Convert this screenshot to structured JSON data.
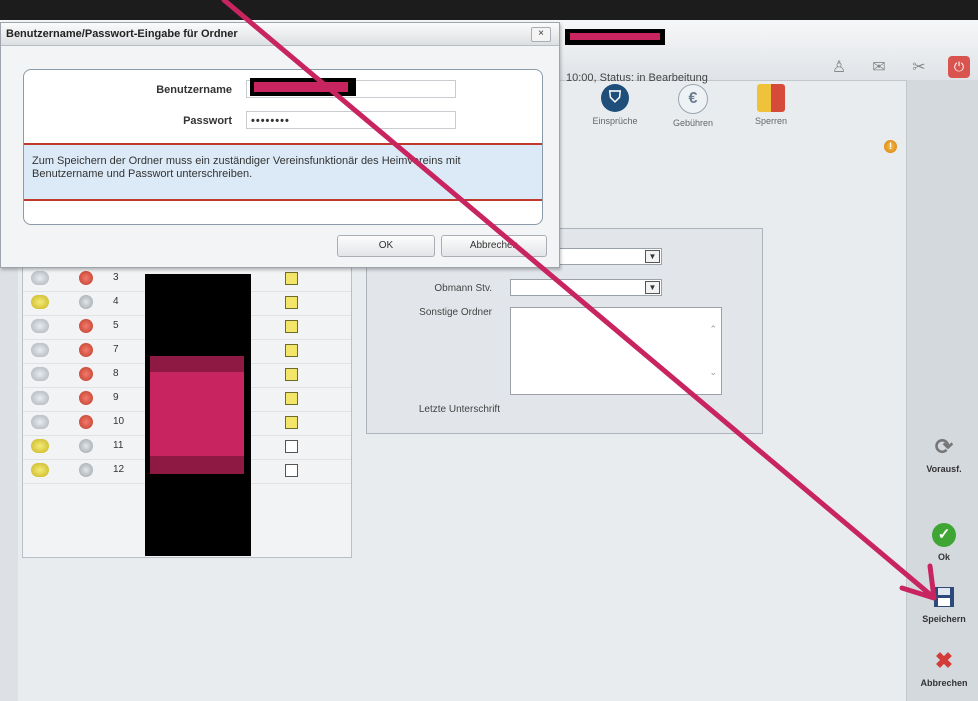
{
  "header": {
    "status_text": "10:00, Status: in Bearbeitung"
  },
  "toolbar": [
    {
      "label": "Einsprüche",
      "icon": "shield-icon",
      "symbol": "⛉",
      "color": "#1e4e79"
    },
    {
      "label": "Gebühren",
      "icon": "euro-icon",
      "symbol": "€",
      "color": "#6a7d90"
    },
    {
      "label": "Sperren",
      "icon": "cards-icon",
      "symbol": "▰",
      "color": "#e2a52b"
    }
  ],
  "sidebar": {
    "vorausfuellen": "Vorausf.",
    "ok": "Ok",
    "speichern": "Speichern",
    "abbrechen": "Abbrechen"
  },
  "table": {
    "rows": [
      {
        "num": "3",
        "ic1": "grey",
        "ic2": "red",
        "chk": "yellow"
      },
      {
        "num": "4",
        "ic1": "yellow",
        "ic2": "grey",
        "chk": "yellow"
      },
      {
        "num": "5",
        "ic1": "grey",
        "ic2": "red",
        "chk": "yellow"
      },
      {
        "num": "7",
        "ic1": "grey",
        "ic2": "red",
        "chk": "yellow"
      },
      {
        "num": "8",
        "ic1": "grey",
        "ic2": "red",
        "chk": "yellow"
      },
      {
        "num": "9",
        "ic1": "grey",
        "ic2": "red",
        "chk": "yellow"
      },
      {
        "num": "10",
        "ic1": "grey",
        "ic2": "red",
        "chk": "yellow"
      },
      {
        "num": "11",
        "ic1": "yellow",
        "ic2": "grey",
        "chk": "white"
      },
      {
        "num": "12",
        "ic1": "yellow",
        "ic2": "grey",
        "chk": "white"
      }
    ]
  },
  "form": {
    "obmann_stv_label": "Obmann Stv.",
    "sonstige_ordner_label": "Sonstige Ordner",
    "letzte_unterschrift_label": "Letzte Unterschrift"
  },
  "dialog": {
    "title": "Benutzername/Passwort-Eingabe für Ordner",
    "close": "×",
    "username_label": "Benutzername",
    "password_label": "Passwort",
    "password_value": "••••••••",
    "message": "Zum Speichern der Ordner muss ein zuständiger Vereinsfunktionär des Heimvereins mit Benutzername und Passwort unterschreiben.",
    "ok_label": "OK",
    "cancel_label": "Abbrechen"
  },
  "colors": {
    "accent_red": "#c0392b",
    "annotation_arrow": "#c8245f"
  }
}
